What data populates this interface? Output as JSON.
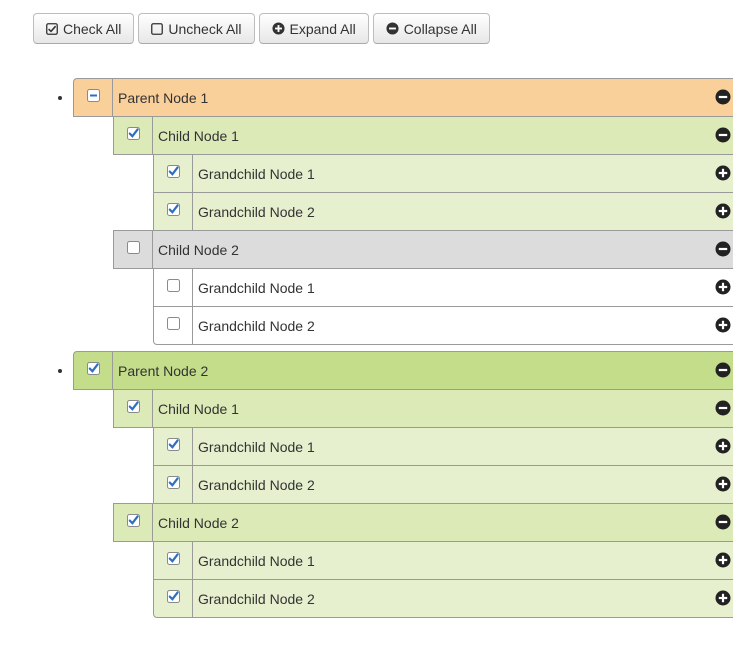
{
  "toolbar": {
    "check_all": "Check All",
    "uncheck_all": "Uncheck All",
    "expand_all": "Expand All",
    "collapse_all": "Collapse All"
  },
  "tree": {
    "parent1": {
      "label": "Parent Node 1",
      "checkbox_state": "indeterminate",
      "toggle": "collapse",
      "child1": {
        "label": "Child Node 1",
        "checkbox_state": "checked",
        "toggle": "collapse",
        "grandchild1": {
          "label": "Grandchild Node 1",
          "checkbox_state": "checked",
          "toggle": "expand"
        },
        "grandchild2": {
          "label": "Grandchild Node 2",
          "checkbox_state": "checked",
          "toggle": "expand"
        }
      },
      "child2": {
        "label": "Child Node 2",
        "checkbox_state": "unchecked",
        "toggle": "collapse",
        "grandchild1": {
          "label": "Grandchild Node 1",
          "checkbox_state": "unchecked",
          "toggle": "expand"
        },
        "grandchild2": {
          "label": "Grandchild Node 2",
          "checkbox_state": "unchecked",
          "toggle": "expand"
        }
      }
    },
    "parent2": {
      "label": "Parent Node 2",
      "checkbox_state": "checked",
      "toggle": "collapse",
      "child1": {
        "label": "Child Node 1",
        "checkbox_state": "checked",
        "toggle": "collapse",
        "grandchild1": {
          "label": "Grandchild Node 1",
          "checkbox_state": "checked",
          "toggle": "expand"
        },
        "grandchild2": {
          "label": "Grandchild Node 2",
          "checkbox_state": "checked",
          "toggle": "expand"
        }
      },
      "child2": {
        "label": "Child Node 2",
        "checkbox_state": "checked",
        "toggle": "collapse",
        "grandchild1": {
          "label": "Grandchild Node 1",
          "checkbox_state": "checked",
          "toggle": "expand"
        },
        "grandchild2": {
          "label": "Grandchild Node 2",
          "checkbox_state": "checked",
          "toggle": "expand"
        }
      }
    }
  },
  "colors": {
    "partial": "#f9cf9a",
    "checked_parent": "#c4dd8b",
    "checked_child": "#dceab8",
    "checked_leaf": "#e6f0ce",
    "unchecked_child": "#dcdcdc",
    "unchecked_leaf": "#ffffff",
    "icon_dark": "#222222",
    "checkbox_fill": "#2f6fbf"
  }
}
